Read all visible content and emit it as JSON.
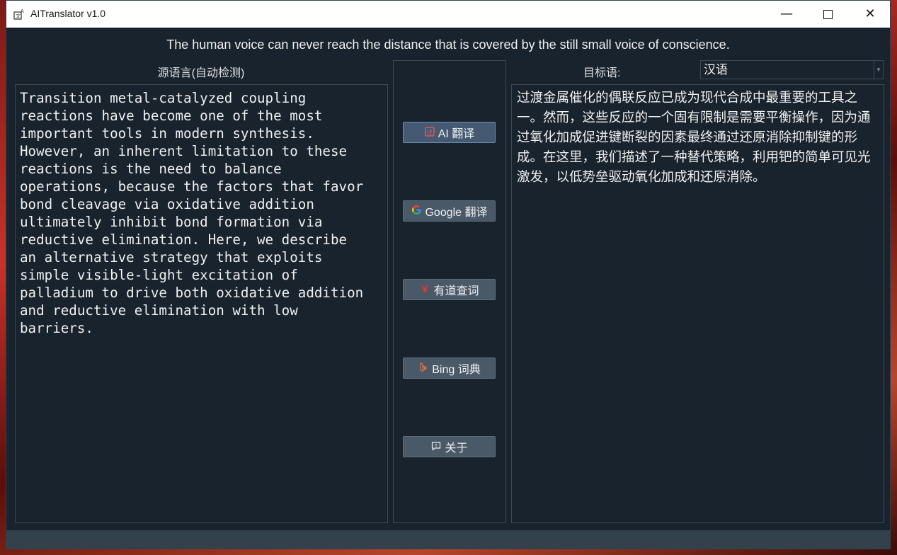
{
  "window": {
    "title": "AITranslator  v1.0",
    "minimize": "—",
    "close": "✕"
  },
  "quote": "The human voice can never reach the distance that is covered by the still small voice of conscience.",
  "source": {
    "label": "源语言(自动检测)",
    "text": "Transition metal-catalyzed coupling\nreactions have become one of the most\nimportant tools in modern synthesis.\nHowever, an inherent limitation to these\nreactions is the need to balance\noperations, because the factors that favor\nbond cleavage via oxidative addition\nultimately inhibit bond formation via\nreductive elimination. Here, we describe\nan alternative strategy that exploits\nsimple visible-light excitation of\npalladium to drive both oxidative addition\nand reductive elimination with low\nbarriers."
  },
  "buttons": {
    "ai": "AI 翻译",
    "google": "Google 翻译",
    "youdao": "有道查词",
    "bing": "Bing 词典",
    "about": "关于"
  },
  "target": {
    "label": "目标语:",
    "language": "汉语",
    "text": "过渡金属催化的偶联反应已成为现代合成中最重要的工具之一。然而，这些反应的一个固有限制是需要平衡操作，因为通过氧化加成促进键断裂的因素最终通过还原消除抑制键的形成。在这里，我们描述了一种替代策略，利用钯的简单可见光激发，以低势垒驱动氧化加成和还原消除。"
  }
}
